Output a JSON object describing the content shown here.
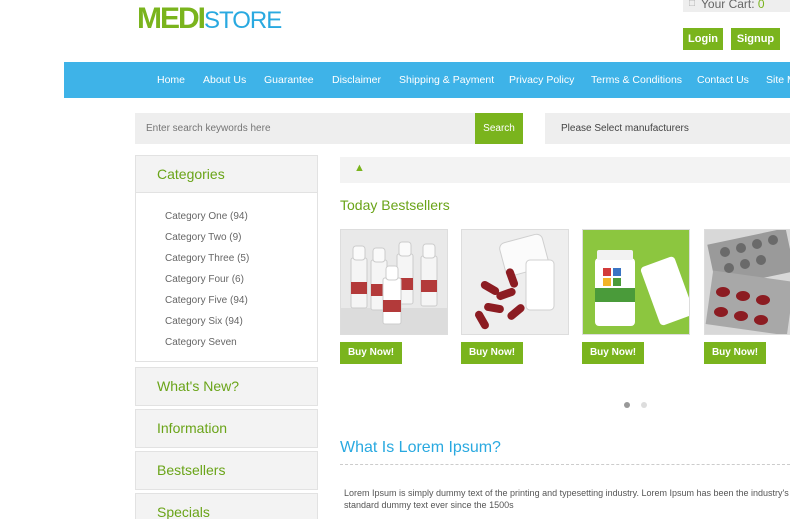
{
  "header": {
    "logo_medi": "MEDI",
    "logo_store": "STORE",
    "cart_label": "Your Cart: ",
    "cart_count": "0",
    "login_label": "Login",
    "signup_label": "Signup"
  },
  "nav": {
    "items": [
      "Home",
      "About Us",
      "Guarantee",
      "Disclaimer",
      "Shipping & Payment",
      "Privacy Policy",
      "Terms & Conditions",
      "Contact Us",
      "Site Map"
    ]
  },
  "search": {
    "placeholder": "Enter search keywords here",
    "button_label": "Search",
    "manufacturer_label": "Please Select manufacturers"
  },
  "sidebar": {
    "categories_title": "Categories",
    "categories": [
      "Category One (94)",
      "Category Two (9)",
      "Category Three (5)",
      "Category Four (6)",
      "Category Five (94)",
      "Category Six (94)",
      "Category Seven"
    ],
    "boxes": [
      "What's New?",
      "Information",
      "Bestsellers",
      "Specials"
    ]
  },
  "main": {
    "bestsellers_title": "Today Bestsellers",
    "buy_label": "Buy Now!",
    "lorem_title": "What Is Lorem Ipsum?",
    "lorem_text": "Lorem Ipsum is simply dummy text of the printing and typesetting industry. Lorem Ipsum has been the industry's standard dummy text ever since the 1500s"
  },
  "colors": {
    "accent_green": "#7ab41d",
    "nav_blue": "#3eb3e8",
    "title_blue": "#29a9e0"
  },
  "icons": [
    "cart-icon",
    "home-icon"
  ]
}
